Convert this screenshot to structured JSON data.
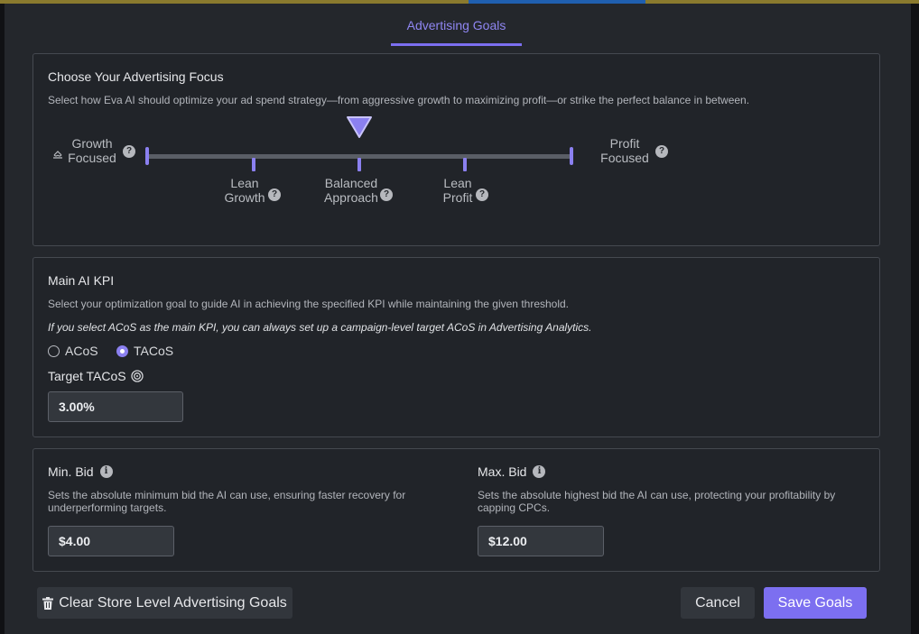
{
  "tab": {
    "label": "Advertising Goals"
  },
  "focus": {
    "title": "Choose Your Advertising Focus",
    "description": "Select how Eva AI should optimize your ad spend strategy—from aggressive growth to maximizing profit—or strike the perfect balance in between.",
    "left_line1": "Growth",
    "left_line2": "Focused",
    "right_line1": "Profit",
    "right_line2": "Focused",
    "options": [
      {
        "line1": "Lean",
        "line2": "Growth"
      },
      {
        "line1": "Balanced",
        "line2": "Approach"
      },
      {
        "line1": "Lean",
        "line2": "Profit"
      }
    ],
    "selected": "Balanced Approach",
    "help_glyph": "?"
  },
  "kpi": {
    "title": "Main AI KPI",
    "description": "Select your optimization goal to guide AI in achieving the specified KPI while maintaining the given threshold.",
    "note": "If you select ACoS as the main KPI, you can always set up a campaign-level target ACoS in Advertising Analytics.",
    "options": [
      {
        "label": "ACoS",
        "selected": false
      },
      {
        "label": "TACoS",
        "selected": true
      }
    ],
    "target_label": "Target TACoS",
    "target_value": "3.00%"
  },
  "bids": {
    "min": {
      "label": "Min. Bid",
      "description": "Sets the absolute minimum bid the AI can use, ensuring faster recovery for underperforming targets.",
      "value": "$4.00"
    },
    "max": {
      "label": "Max. Bid",
      "description": "Sets the absolute highest bid the AI can use, protecting your profitability by capping CPCs.",
      "value": "$12.00"
    },
    "info_glyph": "i"
  },
  "footer": {
    "clear_label": "Clear Store Level Advertising Goals",
    "cancel_label": "Cancel",
    "save_label": "Save Goals"
  },
  "colors": {
    "accent": "#7c6ff0",
    "background": "#24272c",
    "panel": "#212429"
  },
  "icons": [
    "help-icon",
    "info-icon",
    "target-icon",
    "trash-icon",
    "balance-scale-icon"
  ]
}
